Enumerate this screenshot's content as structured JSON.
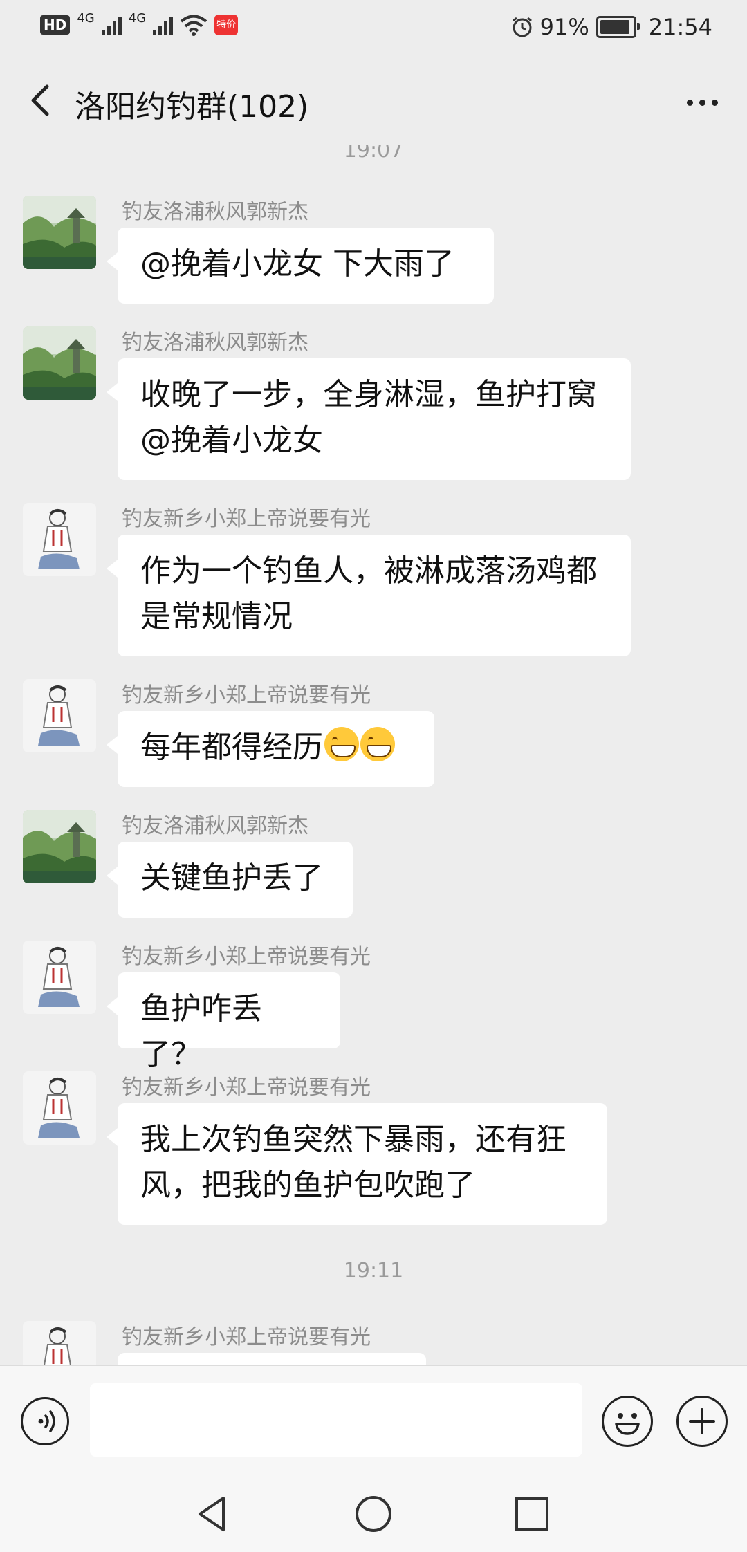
{
  "status_bar": {
    "hd_label": "HD",
    "network_1": "4G",
    "network_2": "4G",
    "app_badge": "特价",
    "battery_percent": "91%",
    "time": "21:54"
  },
  "nav": {
    "title": "洛阳约钓群(102)"
  },
  "chat": {
    "time_separators": [
      "19:07",
      "19:11"
    ],
    "messages": [
      {
        "sender": "钓友洛浦秋风郭新杰",
        "text": "@挽着小龙女  下大雨了",
        "avatar": "landscape"
      },
      {
        "sender": "钓友洛浦秋风郭新杰",
        "lines": [
          "收晚了一步，全身淋湿，鱼护打窝",
          "@挽着小龙女"
        ],
        "avatar": "landscape"
      },
      {
        "sender": "钓友新乡小郑上帝说要有光",
        "lines": [
          "作为一个钓鱼人，被淋成落汤鸡都",
          "是常规情况"
        ],
        "avatar": "sketch"
      },
      {
        "sender": "钓友新乡小郑上帝说要有光",
        "text": "每年都得经历",
        "emoji": "grin-emoji",
        "emoji_count": 2,
        "avatar": "sketch"
      },
      {
        "sender": "钓友洛浦秋风郭新杰",
        "text": "关键鱼护丢了",
        "avatar": "landscape"
      },
      {
        "sender": "钓友新乡小郑上帝说要有光",
        "text": "鱼护咋丢了？",
        "avatar": "sketch"
      },
      {
        "sender": "钓友新乡小郑上帝说要有光",
        "lines": [
          "我上次钓鱼突然下暴雨，还有狂",
          "风，把我的鱼护包吹跑了"
        ],
        "avatar": "sketch"
      },
      {
        "sender": "钓友新乡小郑上帝说要有光",
        "avatar": "sketch"
      }
    ]
  },
  "input": {
    "voice_icon": "voice-icon",
    "emoji_icon": "emoji-icon",
    "plus_icon": "plus-icon"
  },
  "system_nav": {
    "back_icon": "triangle-back-icon",
    "home_icon": "circle-home-icon",
    "recent_icon": "square-recent-icon"
  }
}
